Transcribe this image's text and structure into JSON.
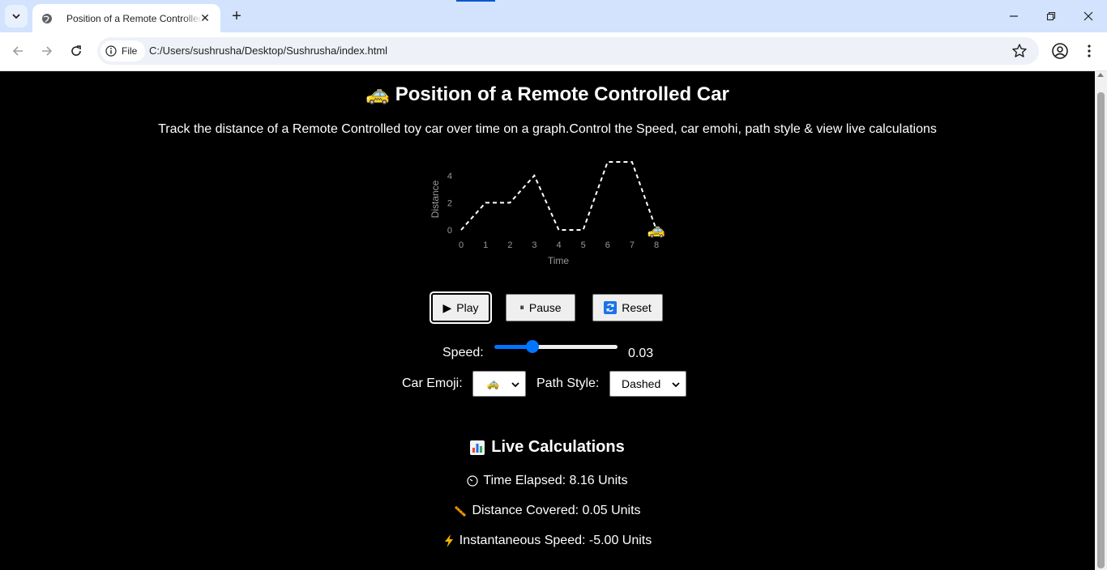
{
  "browser": {
    "tab_title": "Position of a Remote Controlled Car",
    "address_chip": "File",
    "url": "C:/Users/sushrusha/Desktop/Sushrusha/index.html"
  },
  "page": {
    "title_emoji": "🚕",
    "title": "Position of a Remote Controlled Car",
    "subtitle": "Track the distance of a Remote Controlled toy car over time on a graph.Control the Speed, car emohi, path style & view live calculations",
    "controls": {
      "play_label": "Play",
      "pause_label": "Pause",
      "reset_label": "Reset",
      "speed_label": "Speed:",
      "speed_value": "0.03",
      "speed_slider_fraction": 0.29,
      "car_emoji_label": "Car Emoji:",
      "car_emoji_selected": "🚕",
      "path_style_label": "Path Style:",
      "path_style_selected": "Dashed"
    },
    "calculations": {
      "heading": "Live Calculations",
      "time_elapsed": "Time Elapsed: 8.16 Units",
      "distance_covered": "Distance Covered: 0.05 Units",
      "instantaneous_speed": "Instantaneous Speed: -5.00 Units"
    },
    "colors": {
      "background": "#000000",
      "text": "#ffffff",
      "axis_text": "#999999",
      "slider_accent": "#0075ff",
      "bolt": "#f4b400",
      "ruler": "#f29900"
    }
  },
  "chart_data": {
    "type": "line",
    "xlabel": "Time",
    "ylabel": "Distance",
    "x_ticks": [
      "0",
      "1",
      "2",
      "3",
      "4",
      "5",
      "6",
      "7",
      "8"
    ],
    "y_ticks": [
      "0",
      "2",
      "4"
    ],
    "x": [
      0,
      1,
      2,
      3,
      4,
      5,
      6,
      7,
      8
    ],
    "y": [
      0,
      2,
      2,
      4,
      0,
      0,
      5,
      5,
      0
    ],
    "xlim": [
      0,
      8
    ],
    "ylim": [
      0,
      5
    ],
    "line_style": "dashed",
    "marker_emoji": "🚕",
    "marker_x": 8.0
  }
}
